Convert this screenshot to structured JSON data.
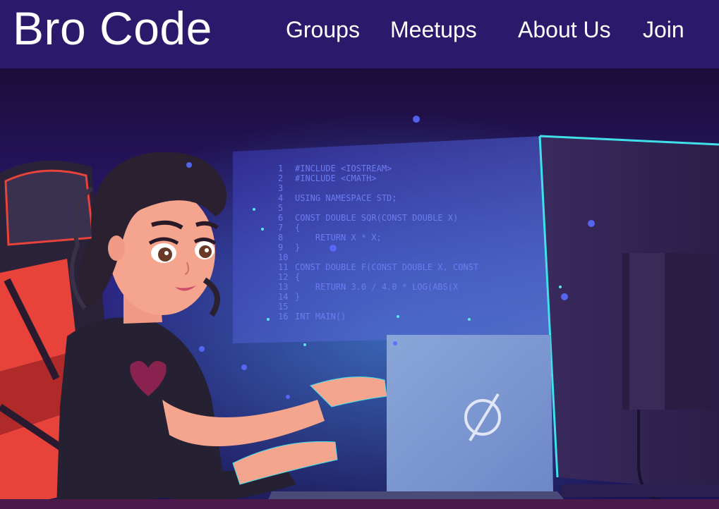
{
  "navbar": {
    "brand": "Bro Code",
    "links": [
      {
        "label": "Groups"
      },
      {
        "label": "Meetups"
      },
      {
        "label": "About Us"
      },
      {
        "label": "Join"
      }
    ]
  },
  "hero": {
    "code_lines": [
      {
        "num": "1",
        "text": "#INCLUDE <IOSTREAM>"
      },
      {
        "num": "2",
        "text": "#INCLUDE <CMATH>"
      },
      {
        "num": "3",
        "text": ""
      },
      {
        "num": "4",
        "text": "USING NAMESPACE STD;"
      },
      {
        "num": "5",
        "text": ""
      },
      {
        "num": "6",
        "text": "CONST DOUBLE SQR(CONST DOUBLE X)"
      },
      {
        "num": "7",
        "text": "{"
      },
      {
        "num": "8",
        "text": "    RETURN X * X;"
      },
      {
        "num": "9",
        "text": "}"
      },
      {
        "num": "10",
        "text": ""
      },
      {
        "num": "11",
        "text": "CONST DOUBLE F(CONST DOUBLE X, CONST"
      },
      {
        "num": "12",
        "text": "{"
      },
      {
        "num": "13",
        "text": "    RETURN 3.0 / 4.0 * LOG(ABS(X"
      },
      {
        "num": "14",
        "text": "}"
      },
      {
        "num": "15",
        "text": ""
      },
      {
        "num": "16",
        "text": "INT MAIN()"
      }
    ],
    "laptop_logo": "∅"
  },
  "colors": {
    "navbar": "#2b1a6b",
    "background": "#1a1040",
    "accent_cyan": "#3fe0e8",
    "chair_red": "#e8433a"
  }
}
